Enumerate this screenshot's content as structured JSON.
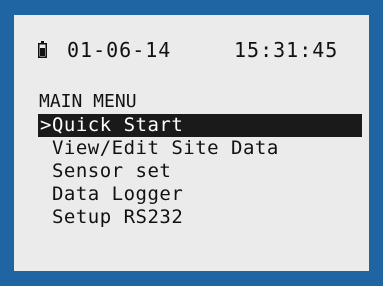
{
  "status_bar": {
    "battery_icon": "battery-icon",
    "date": "01-06-14",
    "time": "15:31:45"
  },
  "menu": {
    "title": "MAIN MENU",
    "items": [
      {
        "label": ">Quick Start",
        "selected": true
      },
      {
        "label": " View/Edit Site Data",
        "selected": false
      },
      {
        "label": " Sensor set",
        "selected": false
      },
      {
        "label": " Data Logger",
        "selected": false
      },
      {
        "label": " Setup RS232",
        "selected": false
      }
    ]
  },
  "colors": {
    "bezel": "#1f64a3",
    "screen": "#ebebeb",
    "text": "#111111",
    "highlight": "#1a1a1a"
  }
}
